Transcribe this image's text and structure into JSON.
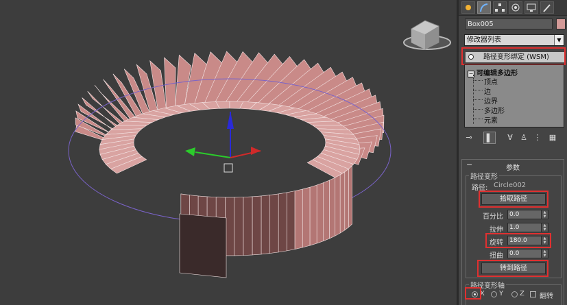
{
  "panel": {
    "tabs": [
      "create-tab",
      "modify-tab",
      "hierarchy-tab",
      "motion-tab",
      "display-tab",
      "utilities-tab"
    ],
    "object_name": "Box005",
    "object_color": "#e3a0a0",
    "modifier_list_label": "修改器列表",
    "modifier_item": "路径变形绑定 (WSM)",
    "stack_base": "可编辑多边形",
    "stack_sub": [
      "顶点",
      "边",
      "边界",
      "多边形",
      "元素"
    ]
  },
  "params": {
    "title": "参数",
    "group_title": "路径变形",
    "path_label": "路径:",
    "path_value": "Circle002",
    "pick_path": "拾取路径",
    "percent_label": "百分比",
    "percent_value": "0.0",
    "stretch_label": "拉伸",
    "stretch_value": "1.0",
    "rotate_label": "旋转",
    "rotate_value": "180.0",
    "twist_label": "扭曲",
    "twist_value": "0.0",
    "goto_path": "转到路径",
    "axis_group": "路径变形轴",
    "axis_x": "X",
    "axis_y": "Y",
    "axis_z": "Z",
    "flip": "翻转"
  },
  "colors": {
    "highlight": "#e03030",
    "mesh": "#d39a98"
  }
}
